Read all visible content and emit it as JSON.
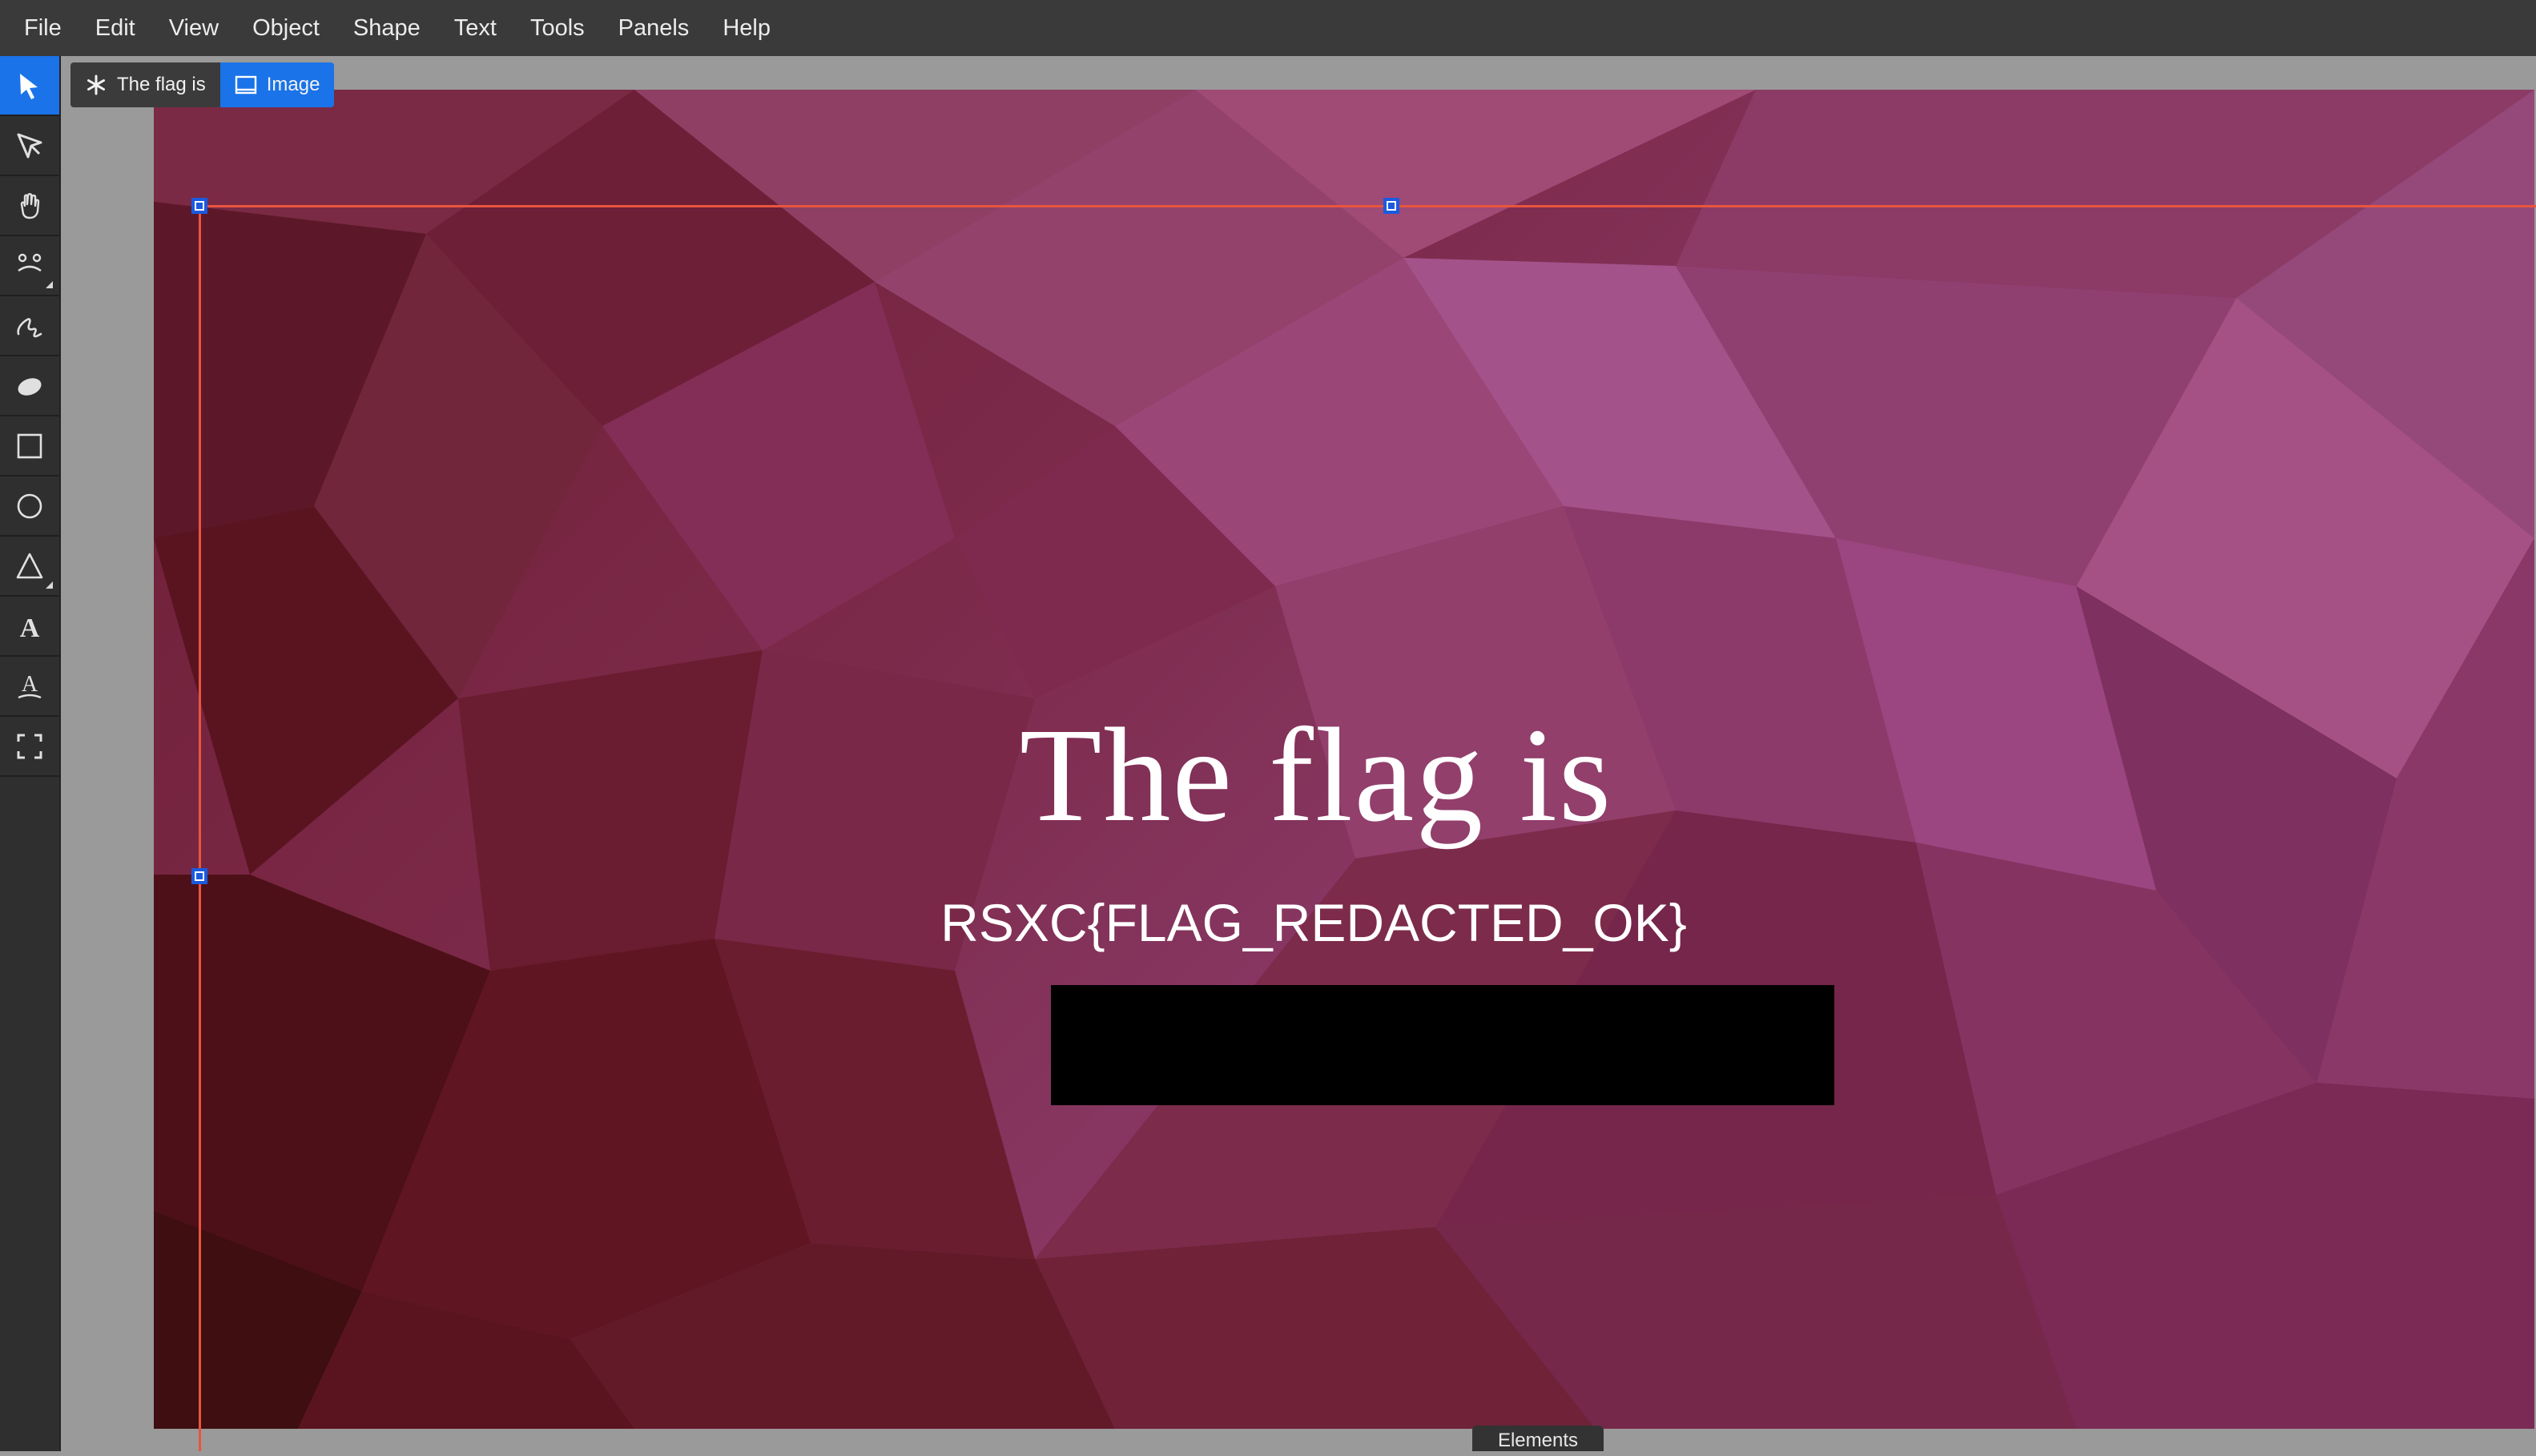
{
  "menu": {
    "items": [
      "File",
      "Edit",
      "View",
      "Object",
      "Shape",
      "Text",
      "Tools",
      "Panels",
      "Help"
    ]
  },
  "toolbar": {
    "tools": [
      {
        "name": "select-tool",
        "icon": "arrow-pointer-icon",
        "active": true
      },
      {
        "name": "direct-select-tool",
        "icon": "node-pointer-icon",
        "active": false
      },
      {
        "name": "hand-tool",
        "icon": "hand-icon",
        "active": false
      },
      {
        "name": "puppet-tool",
        "icon": "face-icon",
        "active": false
      },
      {
        "name": "pen-tool",
        "icon": "squiggle-icon",
        "active": false
      },
      {
        "name": "ellipse-blob-tool",
        "icon": "blob-icon",
        "active": false
      },
      {
        "name": "rectangle-tool",
        "icon": "square-icon",
        "active": false
      },
      {
        "name": "circle-tool",
        "icon": "circle-icon",
        "active": false
      },
      {
        "name": "polygon-tool",
        "icon": "triangle-icon",
        "active": false
      },
      {
        "name": "text-tool",
        "icon": "letter-a-icon",
        "active": false
      },
      {
        "name": "text-on-path-tool",
        "icon": "letter-a-path-icon",
        "active": false
      },
      {
        "name": "frame-tool",
        "icon": "frame-corners-icon",
        "active": false
      }
    ]
  },
  "breadcrumb": {
    "text_layer": "The flag is",
    "image_layer": "Image"
  },
  "artboard": {
    "headline": "The flag is",
    "flag": "RSXC{FLAG_REDACTED_OK}"
  },
  "bottom_panel": {
    "tab_label": "Elements"
  },
  "colors": {
    "accent": "#1a73e8",
    "guide": "#e8553e",
    "handle": "#1a5ae0",
    "menubar": "#3a3a3a",
    "toolbar": "#2f2f2f",
    "workspace": "#9a9a9a"
  }
}
